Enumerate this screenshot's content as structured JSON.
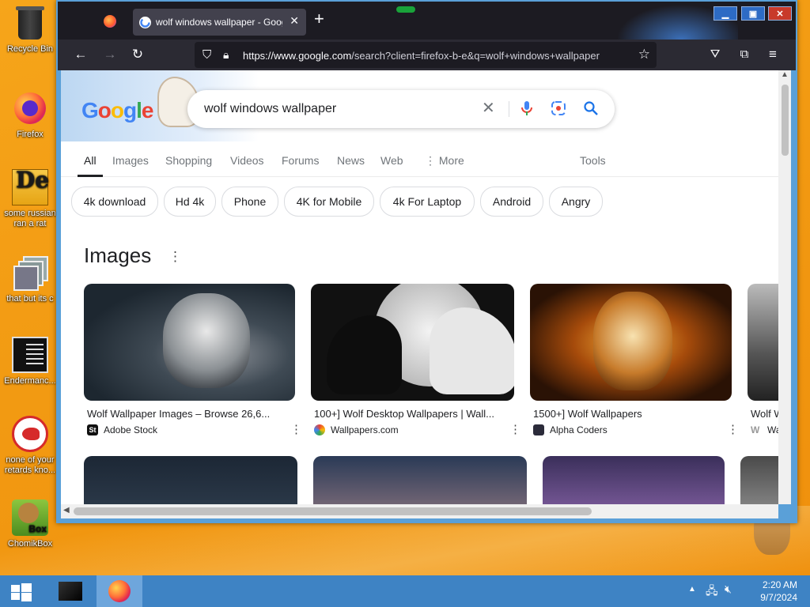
{
  "desktop": {
    "icons": [
      {
        "label": "Recycle Bin",
        "icon": "recycle-bin-icon"
      },
      {
        "label": "Firefox",
        "icon": "firefox-icon"
      },
      {
        "label": "some russian ran a rat",
        "icon": "de-app-icon"
      },
      {
        "label": "that but its c",
        "icon": "stacked-windows-icon"
      },
      {
        "label": "Endermanc...",
        "icon": "console-app-icon"
      },
      {
        "label": "none of your retards kno...",
        "icon": "red-dino-icon"
      },
      {
        "label": "ChomikBox",
        "icon": "chomikbox-icon"
      }
    ]
  },
  "browser": {
    "tab_title": "wolf windows wallpaper - Google",
    "url_domain": "https://www.google.com",
    "url_path": "/search?client=firefox-b-e&q=wolf+windows+wallpaper"
  },
  "google": {
    "logo_text": "Google",
    "query": "wolf windows wallpaper",
    "tabs": [
      "All",
      "Images",
      "Shopping",
      "Videos",
      "Forums",
      "News",
      "Web",
      "More",
      "Tools"
    ],
    "chips": [
      "4k download",
      "Hd 4k",
      "Phone",
      "4K for Mobile",
      "4k For Laptop",
      "Android",
      "Angry"
    ],
    "images_heading": "Images",
    "results": [
      {
        "caption": "Wolf Wallpaper Images – Browse 26,6...",
        "source": "Adobe Stock"
      },
      {
        "caption": "100+] Wolf Desktop Wallpapers | Wall...",
        "source": "Wallpapers.com"
      },
      {
        "caption": "1500+] Wolf Wallpapers",
        "source": "Alpha Coders"
      },
      {
        "caption": "Wolf W",
        "source": "Wa"
      }
    ]
  },
  "taskbar": {
    "time": "2:20 AM",
    "date": "9/7/2024"
  },
  "colors": {
    "desktop": "#f29a12",
    "taskbar": "#3e83c4",
    "titlebar": "#1c1b22",
    "google_blue": "#1a73e8"
  }
}
